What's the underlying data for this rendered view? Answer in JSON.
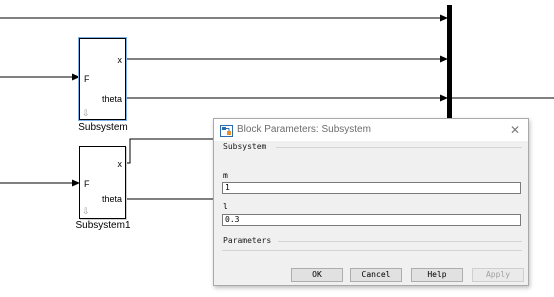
{
  "diagram": {
    "blocks": [
      {
        "id": "subsystem",
        "name": "Subsystem",
        "input_port": "F",
        "output_ports": [
          "x",
          "theta"
        ],
        "library_link_mark": "⇩"
      },
      {
        "id": "subsystem1",
        "name": "Subsystem1",
        "input_port": "F",
        "output_ports": [
          "x",
          "theta"
        ],
        "library_link_mark": "⇩"
      }
    ]
  },
  "dialog": {
    "title": "Block Parameters: Subsystem",
    "icon": "simulink-block-icon",
    "close_icon": "close-icon",
    "close_glyph": "✕",
    "section_title": "Subsystem",
    "params": [
      {
        "label": "m",
        "value": "1"
      },
      {
        "label": "l",
        "value": "0.3"
      }
    ],
    "tab_label": "Parameters",
    "buttons": {
      "ok": "OK",
      "cancel": "Cancel",
      "help": "Help",
      "apply": "Apply"
    }
  }
}
